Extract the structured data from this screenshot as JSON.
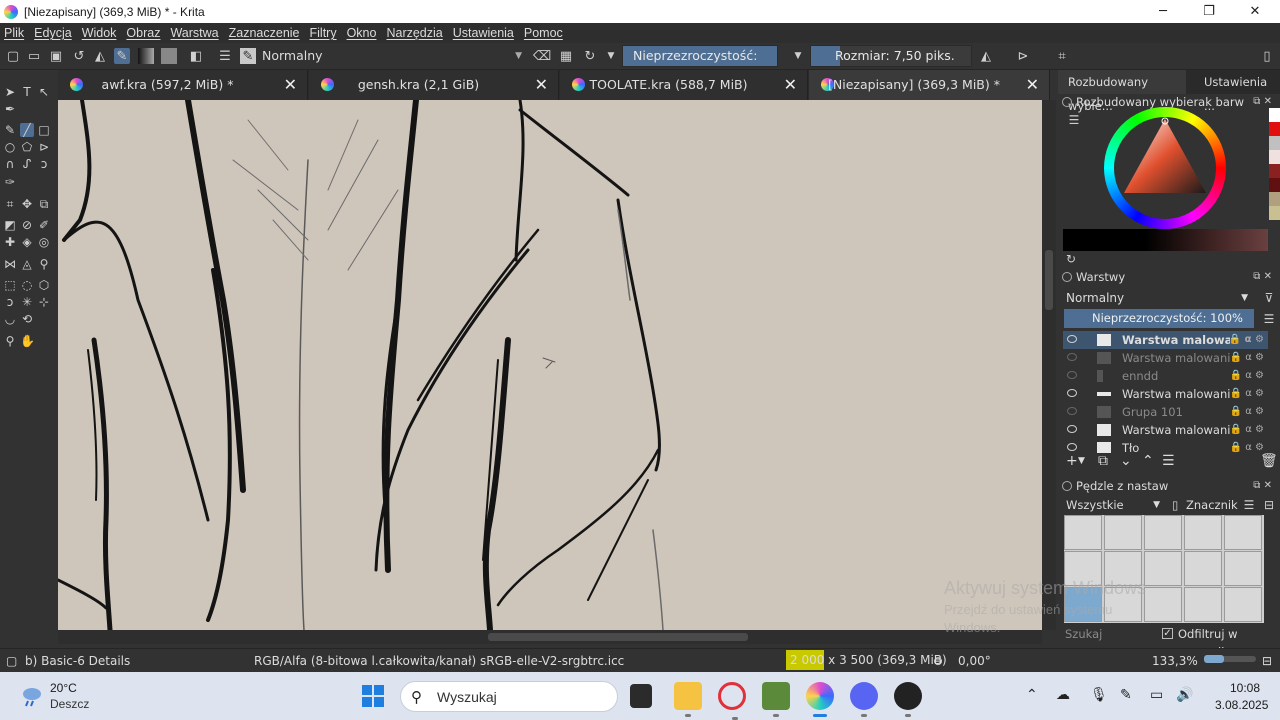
{
  "window": {
    "title": "[Niezapisany]  (369,3 MiB) * - Krita",
    "controls": {
      "minimize": "─",
      "maximize": "❐",
      "close": "✕"
    }
  },
  "menu": [
    "Plik",
    "Edycja",
    "Widok",
    "Obraz",
    "Warstwa",
    "Zaznaczenie",
    "Filtry",
    "Okno",
    "Narzędzia",
    "Ustawienia",
    "Pomoc"
  ],
  "tool_options": {
    "blend_mode": "Normalny",
    "opacity": "Nieprzezroczystość: 100%",
    "size": "Rozmiar: 7,50 piks."
  },
  "tabs": [
    {
      "label": "awf.kra (597,2 MiB) *",
      "close": "✕"
    },
    {
      "label": "gensh.kra (2,1 GiB)",
      "close": "✕"
    },
    {
      "label": "TOOLATE.kra (588,7 MiB)",
      "close": "✕"
    },
    {
      "label": "[Niezapisany]  (369,3 MiB) *",
      "close": "✕"
    }
  ],
  "docker": {
    "tabs": [
      "Rozbudowany wybie...",
      "Ustawienia ..."
    ],
    "color_panel_title": "Rozbudowany wybierak barw",
    "layers_title": "Warstwy",
    "layer_blend": "Normalny",
    "layer_opacity": "Nieprzezroczystość:  100%",
    "layers": [
      {
        "name": "Warstwa malowan...",
        "visible": true,
        "state": "selected"
      },
      {
        "name": "Warstwa malowania...",
        "visible": false,
        "state": "dim"
      },
      {
        "name": "enndd",
        "visible": false,
        "state": "dim"
      },
      {
        "name": "Warstwa malowania 1",
        "visible": true,
        "state": "normal"
      },
      {
        "name": "Grupa 101",
        "visible": false,
        "state": "dim"
      },
      {
        "name": "Warstwa malowania 1",
        "visible": true,
        "state": "normal"
      },
      {
        "name": "Tło",
        "visible": true,
        "state": "normal"
      }
    ],
    "brushes_title": "Pędzle z nastaw",
    "brush_filter": "Wszystkie",
    "brush_tag": "Znacznik",
    "brush_search_placeholder": "Szukaj",
    "filter_in_tag": "Odfiltruj w znaczniku"
  },
  "watermark": {
    "line1": "Aktywuj system Windows",
    "line2": "Przejdź do ustawień systemu",
    "line3": "Windows."
  },
  "status": {
    "brush": "b) Basic-6 Details",
    "color_space": "RGB/Alfa (8-bitowa l.całkowita/kanał)  sRGB-elle-V2-srgbtrc.icc",
    "size": "2 000 x 3 500 (369,3 MiB)",
    "rotation": "0,00°",
    "zoom": "133,3%"
  },
  "taskbar": {
    "temperature": "20°C",
    "weather": "Deszcz",
    "search_placeholder": "Wyszukaj",
    "time": "10:08",
    "date": "3.08.2025"
  }
}
